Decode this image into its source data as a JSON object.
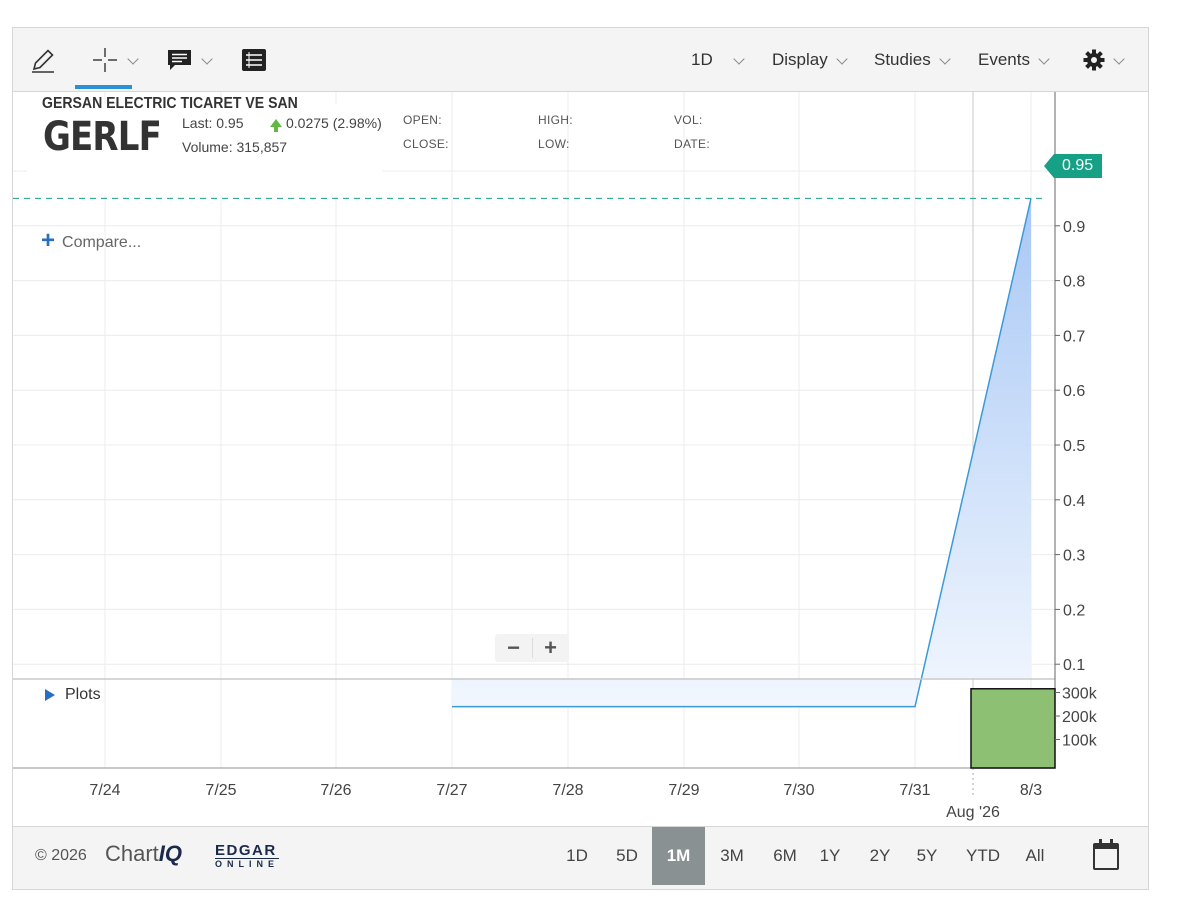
{
  "toolbar": {
    "interval_label": "1D",
    "display_label": "Display",
    "studies_label": "Studies",
    "events_label": "Events"
  },
  "header": {
    "symbol": "GERLF",
    "last_text": "Last: 0.95",
    "change_text": "0.0275 (2.98%)",
    "volume_text": "Volume: 315,857",
    "company": "GERSAN ELECTRIC TICARET VE SAN",
    "open_label": "OPEN:",
    "close_label": "CLOSE:",
    "high_label": "HIGH:",
    "low_label": "LOW:",
    "vol_label": "VOL:",
    "date_label": "DATE:"
  },
  "compare_label": "Compare...",
  "plots_label": "Plots",
  "current_price_tag": "0.95",
  "colors": {
    "line": "#3a9ad9",
    "area_top": "#a9c8f5",
    "area_bottom": "#f2f7fe",
    "price_tag": "#16a085",
    "volume_bar": "#8dc073",
    "up_arrow": "#63b83f",
    "active_range": "#8a9193"
  },
  "chart_data": {
    "type": "area",
    "x": [
      "7/27",
      "7/28",
      "7/29",
      "7/30",
      "7/31",
      "8/3"
    ],
    "values": [
      0.0225,
      0.0225,
      0.0225,
      0.0225,
      0.0225,
      0.95
    ],
    "x_tick_labels": [
      "7/24",
      "7/25",
      "7/26",
      "7/27",
      "7/28",
      "7/29",
      "7/30",
      "7/31",
      "8/3"
    ],
    "x_month_label": "Aug '26",
    "y_ticks": [
      0.1,
      0.2,
      0.3,
      0.4,
      0.5,
      0.6,
      0.7,
      0.8,
      0.9,
      1
    ],
    "y_tick_labels": [
      "0.1",
      "0.2",
      "0.3",
      "0.4",
      "0.5",
      "0.6",
      "0.7",
      "0.8",
      "0.9",
      "1"
    ],
    "ylim": [
      0,
      1.05
    ],
    "volume": {
      "dates": [
        "8/3"
      ],
      "values": [
        315857
      ],
      "y_ticks": [
        100000,
        200000,
        300000
      ],
      "y_tick_labels": [
        "100k",
        "200k",
        "300k"
      ]
    }
  },
  "footer": {
    "copyright": "© 2026",
    "chartiq_text": "Chart",
    "chartiq_bold": "IQ",
    "edgar_top": "EDGAR",
    "edgar_bottom": "ONLINE",
    "ranges": [
      "1D",
      "5D",
      "1M",
      "3M",
      "6M",
      "1Y",
      "2Y",
      "5Y",
      "YTD",
      "All"
    ],
    "active_range": "1M"
  }
}
